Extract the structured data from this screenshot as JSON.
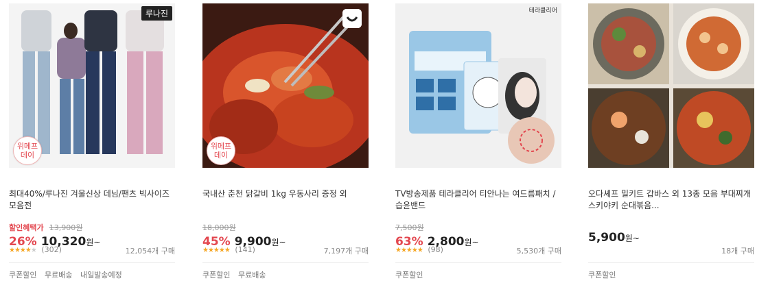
{
  "products": [
    {
      "brand_tag": "루나진",
      "badge": [
        "위메프",
        "데이"
      ],
      "title": "최대40%/루나진 겨울신상 데님/팬츠 빅사이즈 모음전",
      "discount_label": "할인혜택가",
      "original_price": "13,900원",
      "discount_pct": "26%",
      "price": "10,320",
      "won": "원~",
      "stars": 4,
      "reviews": "(302)",
      "purchases": "12,054개 구매",
      "tags": [
        "쿠폰할인",
        "무료배송",
        "내일발송예정"
      ]
    },
    {
      "badge": [
        "위메프",
        "데이"
      ],
      "title": "국내산 춘천 닭갈비 1kg 우동사리 증정 외",
      "original_price": "18,000원",
      "discount_pct": "45%",
      "price": "9,900",
      "won": "원~",
      "stars": 5,
      "reviews": "(141)",
      "purchases": "7,197개 구매",
      "tags": [
        "쿠폰할인",
        "무료배송"
      ]
    },
    {
      "corner_text": "테라클리어",
      "title": "TV방송제품 테라클리어 티안나는 여드름패치 / 습윤밴드",
      "original_price": "7,500원",
      "discount_pct": "63%",
      "price": "2,800",
      "won": "원~",
      "stars": 5,
      "reviews": "(98)",
      "purchases": "5,530개 구매",
      "tags": [
        "쿠폰할인"
      ]
    },
    {
      "title": "오다셰프 밀키트 갑바스 외 13종 모음 부대찌개 스키야키 순대볶음...",
      "price": "5,900",
      "won": "원~",
      "purchases": "18개 구매",
      "tags": [
        "쿠폰할인"
      ]
    }
  ]
}
